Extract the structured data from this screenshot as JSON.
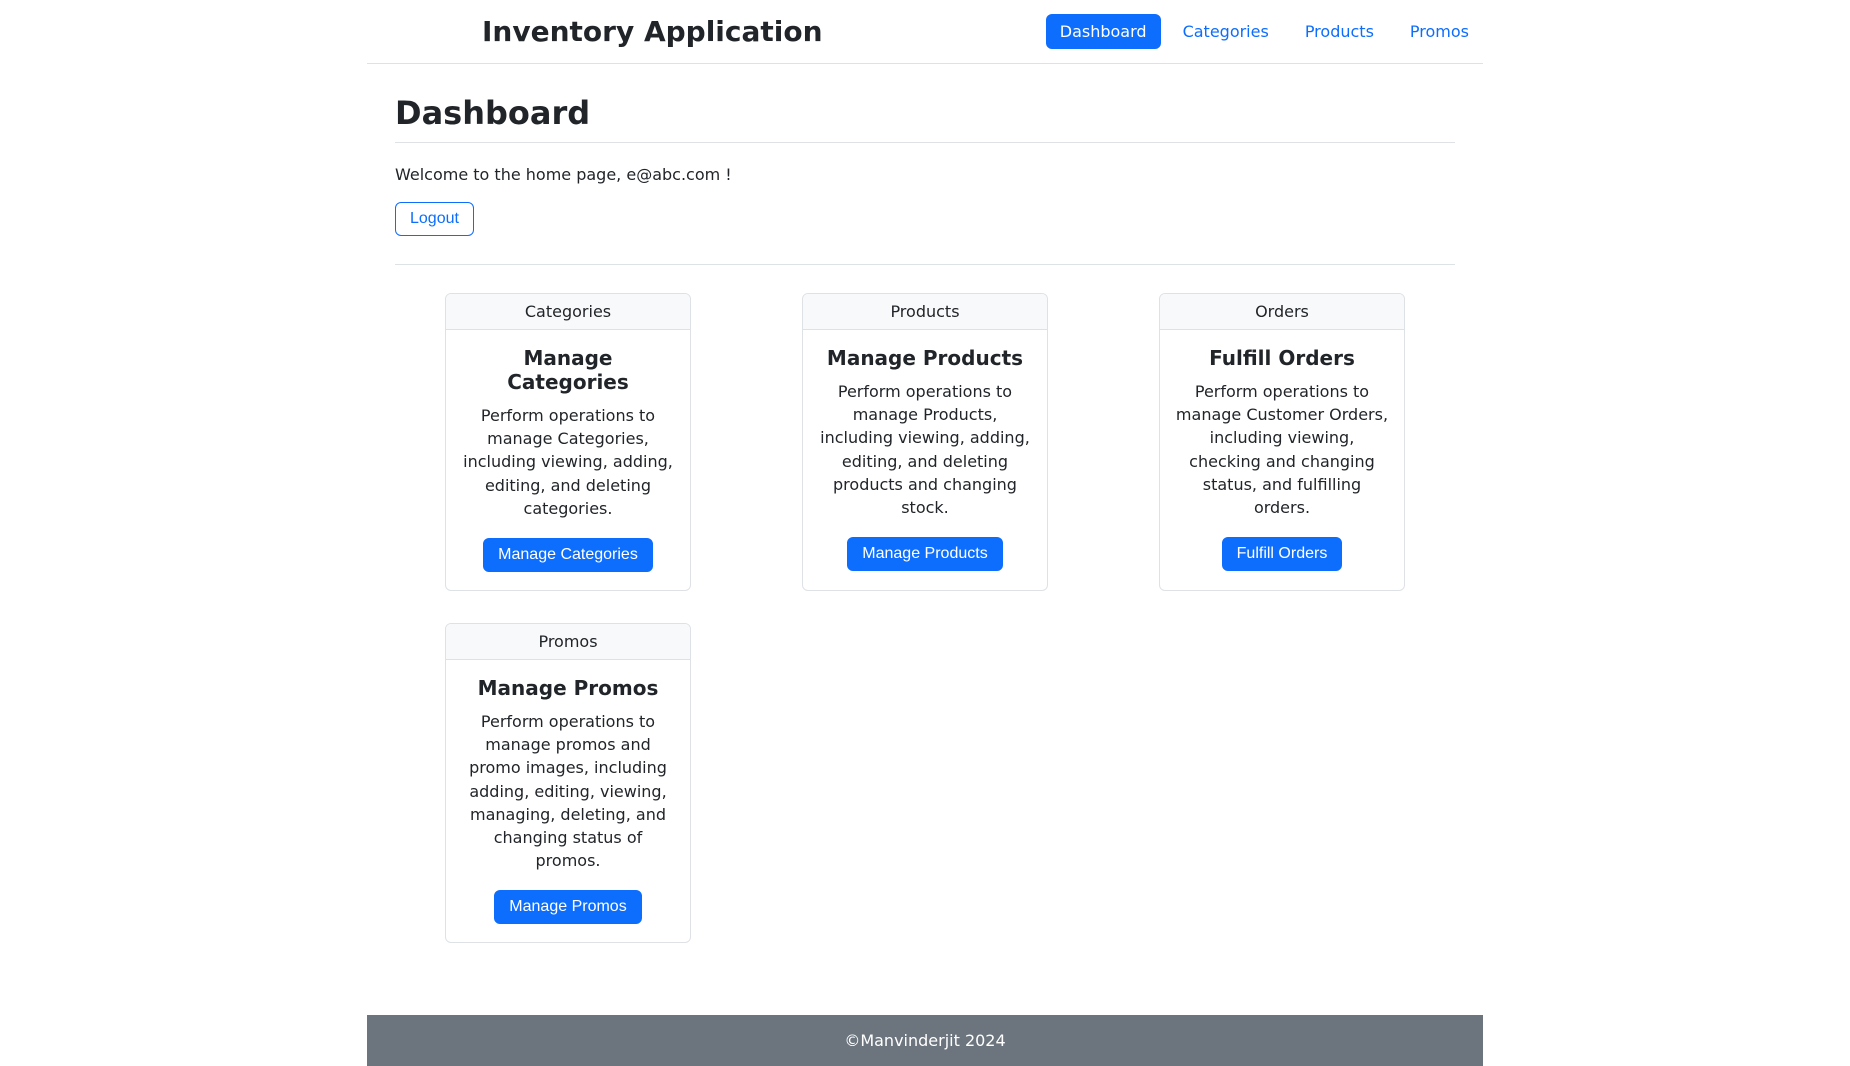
{
  "nav": {
    "brand": "Inventory Application",
    "items": [
      {
        "label": "Dashboard",
        "active": true
      },
      {
        "label": "Categories",
        "active": false
      },
      {
        "label": "Products",
        "active": false
      },
      {
        "label": "Promos",
        "active": false
      }
    ]
  },
  "page": {
    "title": "Dashboard",
    "welcome": "Welcome to the home page, e@abc.com !",
    "logout": "Logout"
  },
  "cards": [
    {
      "header": "Categories",
      "title": "Manage Categories",
      "text": "Perform operations to manage Categories, including viewing, adding, editing, and deleting categories.",
      "button": "Manage Categories"
    },
    {
      "header": "Products",
      "title": "Manage Products",
      "text": "Perform operations to manage Products, including viewing, adding, editing, and deleting products and changing stock.",
      "button": "Manage Products"
    },
    {
      "header": "Orders",
      "title": "Fulfill Orders",
      "text": "Perform operations to manage Customer Orders, including viewing, checking and changing status, and fulfilling orders.",
      "button": "Fulfill Orders"
    },
    {
      "header": "Promos",
      "title": "Manage Promos",
      "text": "Perform operations to manage promos and promo images, including adding, editing, viewing, managing, deleting, and changing status of promos.",
      "button": "Manage Promos"
    }
  ],
  "footer": {
    "text": "©Manvinderjit 2024"
  }
}
